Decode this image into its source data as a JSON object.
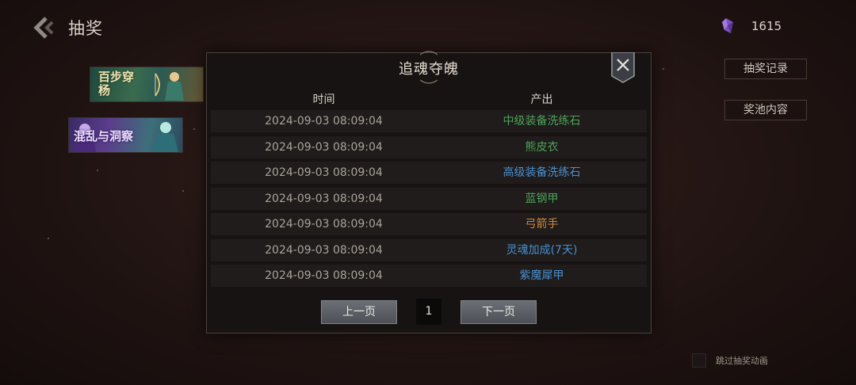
{
  "header": {
    "title": "抽奖",
    "currency": {
      "icon": "purple-gem-icon",
      "amount": "1615"
    }
  },
  "side_buttons": {
    "draw_record": "抽奖记录",
    "pool_content": "奖池内容"
  },
  "banners": [
    {
      "text": "百步穿杨"
    },
    {
      "text": "混乱与洞察"
    }
  ],
  "dialog": {
    "title": "追魂夺魄",
    "columns": {
      "time": "时间",
      "output": "产出"
    },
    "rows": [
      {
        "time": "2024-09-03 08:09:04",
        "item": "中级装备洗练石",
        "color": "#4ea25a"
      },
      {
        "time": "2024-09-03 08:09:04",
        "item": "熊皮衣",
        "color": "#4ea25a"
      },
      {
        "time": "2024-09-03 08:09:04",
        "item": "高级装备洗练石",
        "color": "#4a8fd0"
      },
      {
        "time": "2024-09-03 08:09:04",
        "item": "蓝钢甲",
        "color": "#4ea25a"
      },
      {
        "time": "2024-09-03 08:09:04",
        "item": "弓箭手",
        "color": "#d48a3a"
      },
      {
        "time": "2024-09-03 08:09:04",
        "item": "灵魂加成(7天)",
        "color": "#4a8fd0"
      },
      {
        "time": "2024-09-03 08:09:04",
        "item": "紫魔犀甲",
        "color": "#4a8fd0"
      }
    ],
    "pager": {
      "prev": "上一页",
      "page": "1",
      "next": "下一页"
    }
  },
  "skip_animation_label": "跳过抽奖动画"
}
